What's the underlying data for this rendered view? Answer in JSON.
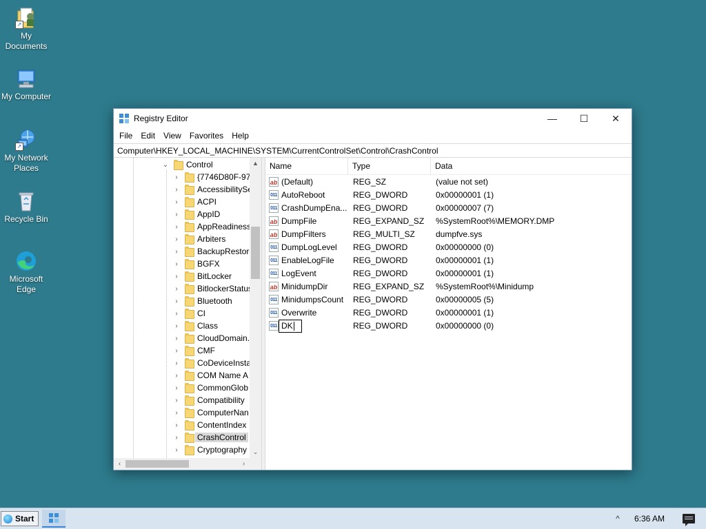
{
  "desktop": {
    "icons": [
      {
        "label": "My Documents",
        "icon": "my-documents-icon"
      },
      {
        "label": "My Computer",
        "icon": "computer-icon"
      },
      {
        "label": "My Network Places",
        "icon": "network-icon"
      },
      {
        "label": "Recycle Bin",
        "icon": "recycle-bin-icon"
      },
      {
        "label": "Microsoft Edge",
        "icon": "edge-icon"
      }
    ]
  },
  "window": {
    "title": "Registry Editor",
    "controls": {
      "minimize": "—",
      "maximize": "☐",
      "close": "✕"
    },
    "menu": [
      "File",
      "Edit",
      "View",
      "Favorites",
      "Help"
    ],
    "address": "Computer\\HKEY_LOCAL_MACHINE\\SYSTEM\\CurrentControlSet\\Control\\CrashControl",
    "tree": {
      "parent": "Control",
      "items": [
        "{7746D80F-97E",
        "AccessibilitySe",
        "ACPI",
        "AppID",
        "AppReadiness",
        "Arbiters",
        "BackupRestore",
        "BGFX",
        "BitLocker",
        "BitlockerStatus",
        "Bluetooth",
        "CI",
        "Class",
        "CloudDomain.",
        "CMF",
        "CoDeviceInsta",
        "COM Name A",
        "CommonGlob",
        "Compatibility",
        "ComputerNan",
        "ContentIndex",
        "CrashControl",
        "Cryptography"
      ],
      "selected": "CrashControl"
    },
    "columns": {
      "name": "Name",
      "type": "Type",
      "data": "Data"
    },
    "values": [
      {
        "kind": "sz",
        "name": "(Default)",
        "type": "REG_SZ",
        "data": "(value not set)"
      },
      {
        "kind": "bin",
        "name": "AutoReboot",
        "type": "REG_DWORD",
        "data": "0x00000001 (1)"
      },
      {
        "kind": "bin",
        "name": "CrashDumpEna...",
        "type": "REG_DWORD",
        "data": "0x00000007 (7)"
      },
      {
        "kind": "sz",
        "name": "DumpFile",
        "type": "REG_EXPAND_SZ",
        "data": "%SystemRoot%\\MEMORY.DMP"
      },
      {
        "kind": "sz",
        "name": "DumpFilters",
        "type": "REG_MULTI_SZ",
        "data": "dumpfve.sys"
      },
      {
        "kind": "bin",
        "name": "DumpLogLevel",
        "type": "REG_DWORD",
        "data": "0x00000000 (0)"
      },
      {
        "kind": "bin",
        "name": "EnableLogFile",
        "type": "REG_DWORD",
        "data": "0x00000001 (1)"
      },
      {
        "kind": "bin",
        "name": "LogEvent",
        "type": "REG_DWORD",
        "data": "0x00000001 (1)"
      },
      {
        "kind": "sz",
        "name": "MinidumpDir",
        "type": "REG_EXPAND_SZ",
        "data": "%SystemRoot%\\Minidump"
      },
      {
        "kind": "bin",
        "name": "MinidumpsCount",
        "type": "REG_DWORD",
        "data": "0x00000005 (5)"
      },
      {
        "kind": "bin",
        "name": "Overwrite",
        "type": "REG_DWORD",
        "data": "0x00000001 (1)"
      }
    ],
    "editing_row": {
      "kind": "bin",
      "name": "DK",
      "type": "REG_DWORD",
      "data": "0x00000000 (0)"
    }
  },
  "taskbar": {
    "start_label": "Start",
    "tray_chevron": "^",
    "clock": "6:36 AM"
  },
  "colors": {
    "desktop": "#2d7b8d",
    "taskbar": "#d8e4f0",
    "selection": "#d9d9d9"
  }
}
